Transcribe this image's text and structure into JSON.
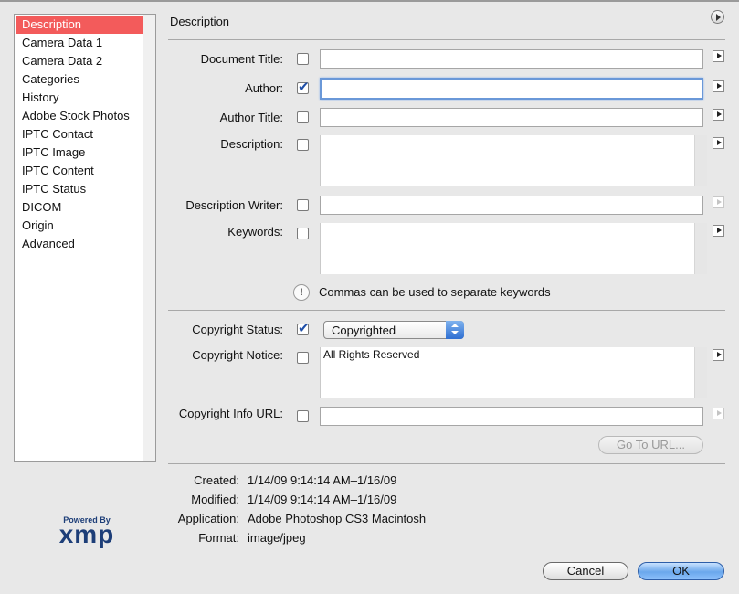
{
  "sidebar": {
    "items": [
      {
        "label": "Description"
      },
      {
        "label": "Camera Data 1"
      },
      {
        "label": "Camera Data 2"
      },
      {
        "label": "Categories"
      },
      {
        "label": "History"
      },
      {
        "label": "Adobe Stock Photos"
      },
      {
        "label": "IPTC Contact"
      },
      {
        "label": "IPTC Image"
      },
      {
        "label": "IPTC Content"
      },
      {
        "label": "IPTC Status"
      },
      {
        "label": "DICOM"
      },
      {
        "label": "Origin"
      },
      {
        "label": "Advanced"
      }
    ],
    "selected": "Description"
  },
  "header": {
    "title": "Description",
    "menu_icon": "circle-arrow-icon"
  },
  "form": {
    "document_title": {
      "label": "Document Title:",
      "value": "",
      "checked": false
    },
    "author": {
      "label": "Author:",
      "value": "",
      "checked": true
    },
    "author_title": {
      "label": "Author Title:",
      "value": "",
      "checked": false
    },
    "description": {
      "label": "Description:",
      "value": "",
      "checked": false
    },
    "description_writer": {
      "label": "Description Writer:",
      "value": "",
      "checked": false
    },
    "keywords": {
      "label": "Keywords:",
      "value": "",
      "checked": false
    },
    "keywords_hint": "Commas can be used to separate keywords",
    "copyright_status": {
      "label": "Copyright Status:",
      "value": "Copyrighted",
      "checked": true
    },
    "copyright_notice": {
      "label": "Copyright Notice:",
      "value": "All Rights Reserved",
      "checked": false
    },
    "copyright_url": {
      "label": "Copyright Info URL:",
      "value": "",
      "checked": false
    },
    "goto_url": "Go To URL..."
  },
  "meta": {
    "created": {
      "label": "Created:",
      "value": "1/14/09 9:14:14 AM–1/16/09"
    },
    "modified": {
      "label": "Modified:",
      "value": "1/14/09 9:14:14 AM–1/16/09"
    },
    "application": {
      "label": "Application:",
      "value": "Adobe Photoshop CS3 Macintosh"
    },
    "format": {
      "label": "Format:",
      "value": "image/jpeg"
    }
  },
  "logo": {
    "small": "Powered By",
    "big": "xmp"
  },
  "buttons": {
    "cancel": "Cancel",
    "ok": "OK"
  },
  "colors": {
    "selection": "#f35b5b",
    "accent": "#6aa7ec",
    "checkmark": "#1f4fa8",
    "logo": "#1d3e78"
  }
}
